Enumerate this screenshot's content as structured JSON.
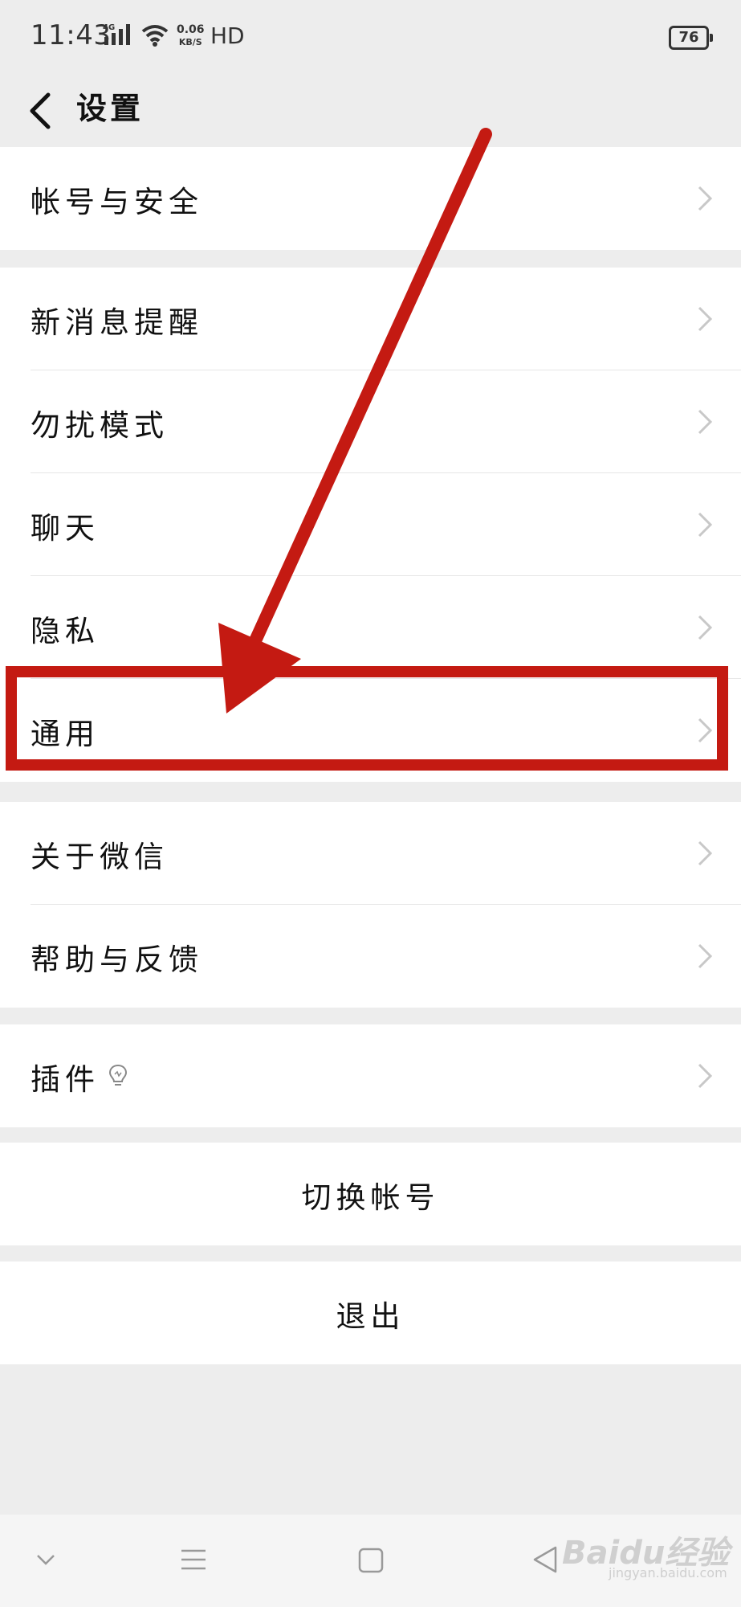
{
  "status_bar": {
    "time": "11:43",
    "network": "4G",
    "speed_value": "0.06",
    "speed_unit": "KB/S",
    "hd": "HD",
    "battery": "76"
  },
  "header": {
    "title": "设置",
    "back_icon": "chevron-left-icon"
  },
  "groups": [
    {
      "items": [
        {
          "label": "帐号与安全"
        }
      ]
    },
    {
      "items": [
        {
          "label": "新消息提醒"
        },
        {
          "label": "勿扰模式"
        },
        {
          "label": "聊天"
        },
        {
          "label": "隐私"
        },
        {
          "label": "通用"
        }
      ]
    },
    {
      "items": [
        {
          "label": "关于微信"
        },
        {
          "label": "帮助与反馈"
        }
      ]
    },
    {
      "items": [
        {
          "label": "插件",
          "icon": "lightbulb-icon"
        }
      ]
    }
  ],
  "actions": {
    "switch_account": "切换帐号",
    "logout": "退出"
  },
  "nav_bar": {
    "icons": [
      "chevron-down-icon",
      "menu-icon",
      "home-square-icon",
      "back-triangle-icon"
    ]
  },
  "annotation": {
    "highlighted_item": "通用",
    "color": "#c41a12"
  },
  "watermark": {
    "brand": "Baidu经验",
    "url": "jingyan.baidu.com"
  },
  "colors": {
    "background": "#ededed",
    "card": "#ffffff",
    "annotation_red": "#c41a12"
  }
}
